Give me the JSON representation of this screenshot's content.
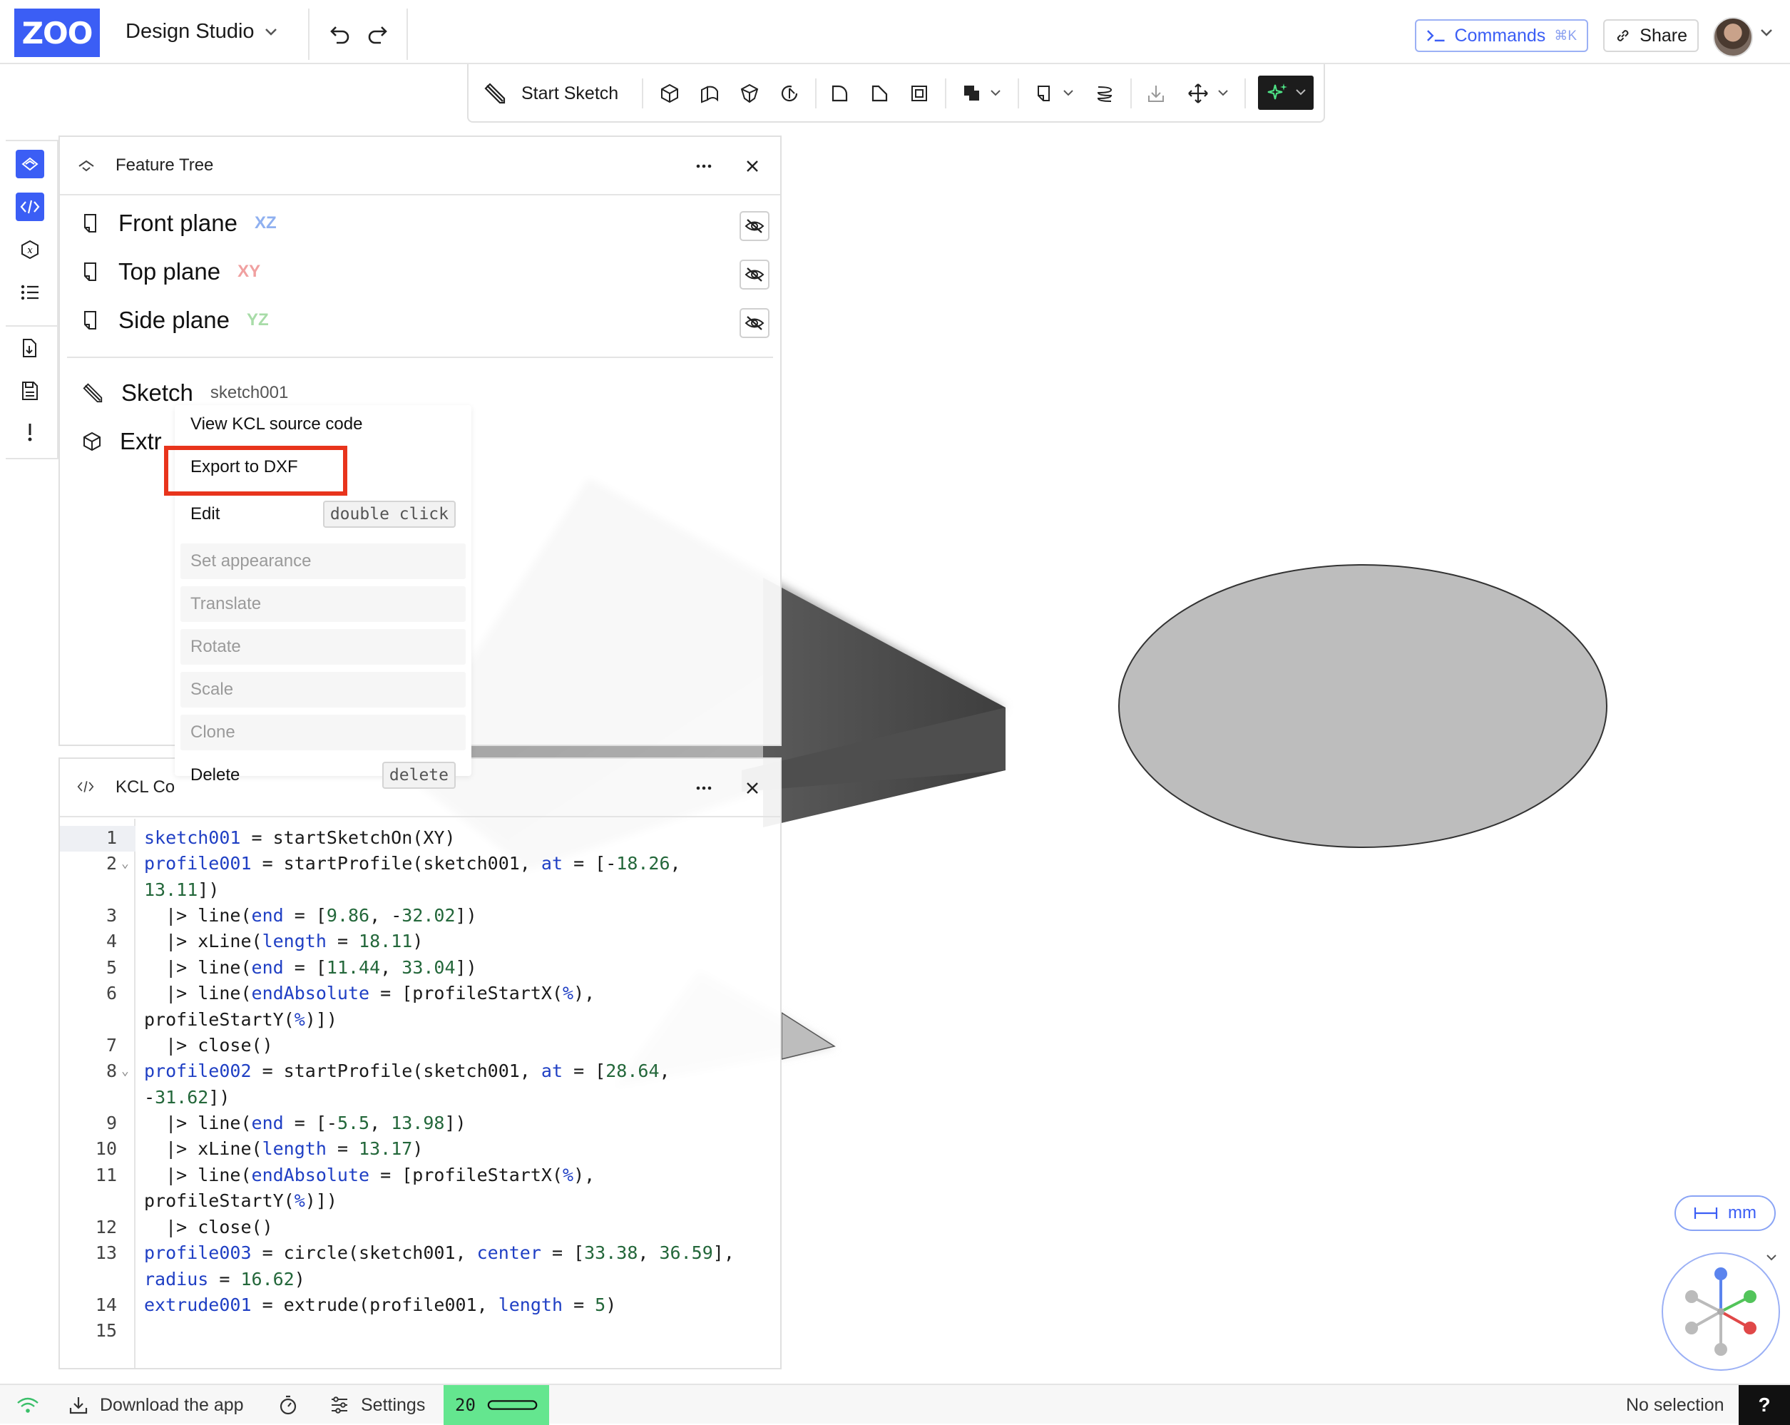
{
  "app": {
    "logo_text": "ZOO",
    "project_name": "Design Studio",
    "brand_color": "#3b5ef5"
  },
  "header": {
    "commands_label": "Commands",
    "commands_shortcut": "⌘K",
    "share_label": "Share"
  },
  "toolbar": {
    "start_sketch_label": "Start Sketch"
  },
  "feature_tree": {
    "title": "Feature Tree",
    "planes": [
      {
        "label": "Front plane",
        "axis": "XZ",
        "axis_color": "#8fb0f0"
      },
      {
        "label": "Top plane",
        "axis": "XY",
        "axis_color": "#f0a0a0"
      },
      {
        "label": "Side plane",
        "axis": "YZ",
        "axis_color": "#a8dca8"
      }
    ],
    "sketch_label": "Sketch",
    "sketch_name": "sketch001",
    "extrude_label_visible": "Extr"
  },
  "context_menu": {
    "items": [
      {
        "label": "View KCL source code",
        "enabled": true,
        "shortcut": ""
      },
      {
        "label": "Export to DXF",
        "enabled": true,
        "shortcut": "",
        "highlighted": true
      },
      {
        "label": "Edit",
        "enabled": true,
        "shortcut": "double click"
      },
      {
        "label": "Set appearance",
        "enabled": false,
        "shortcut": ""
      },
      {
        "label": "Translate",
        "enabled": false,
        "shortcut": ""
      },
      {
        "label": "Rotate",
        "enabled": false,
        "shortcut": ""
      },
      {
        "label": "Scale",
        "enabled": false,
        "shortcut": ""
      },
      {
        "label": "Clone",
        "enabled": false,
        "shortcut": ""
      },
      {
        "label": "Delete",
        "enabled": true,
        "shortcut": "delete"
      }
    ]
  },
  "kcl_panel": {
    "title_visible": "KCL Co",
    "line_numbers": [
      "1",
      "2",
      "",
      "3",
      "4",
      "5",
      "6",
      "",
      "7",
      "8",
      "",
      "9",
      "10",
      "11",
      "",
      "12",
      "13",
      "",
      "14",
      "15"
    ]
  },
  "viewport": {
    "units_label": "mm"
  },
  "statusbar": {
    "download_label": "Download the app",
    "settings_label": "Settings",
    "version": "20",
    "selection_status": "No selection",
    "help_label": "?"
  }
}
